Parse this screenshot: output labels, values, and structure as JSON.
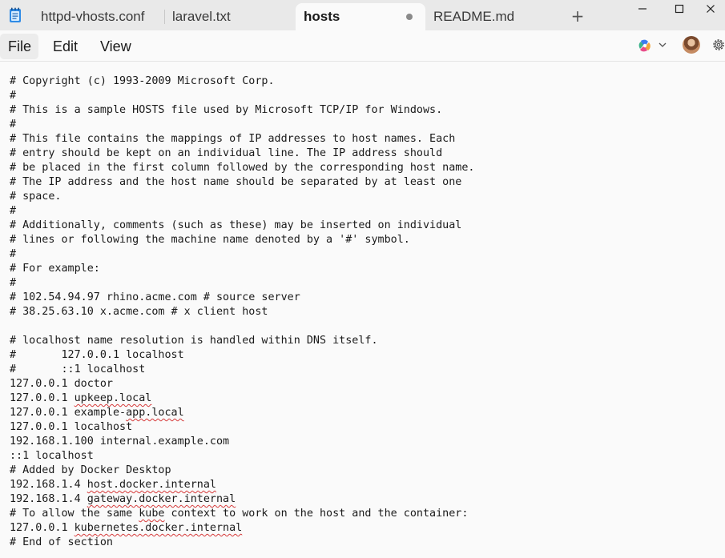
{
  "tabs": [
    {
      "label": "httpd-vhosts.conf",
      "active": false,
      "modified": false
    },
    {
      "label": "laravel.txt",
      "active": false,
      "modified": false
    },
    {
      "label": "hosts",
      "active": true,
      "modified": true
    },
    {
      "label": "README.md",
      "active": false,
      "modified": false
    }
  ],
  "new_tab_symbol": "+",
  "window_controls": {
    "minimize": "minimize-icon",
    "maximize": "maximize-icon",
    "close": "close-icon"
  },
  "menu": {
    "file": "File",
    "edit": "Edit",
    "view": "View"
  },
  "icons": {
    "app": "notepad-icon",
    "copilot": "copilot-icon",
    "chevron": "chevron-down-icon",
    "avatar": "avatar",
    "settings": "gear-icon"
  },
  "colors": {
    "accent": "#1f6fc5",
    "spellcheck": "#d63a3a"
  },
  "document": {
    "lines": [
      {
        "parts": [
          {
            "text": "# Copyright (c) 1993-2009 Microsoft Corp."
          }
        ]
      },
      {
        "parts": [
          {
            "text": "#"
          }
        ]
      },
      {
        "parts": [
          {
            "text": "# This is a sample HOSTS file used by Microsoft TCP/IP for Windows."
          }
        ]
      },
      {
        "parts": [
          {
            "text": "#"
          }
        ]
      },
      {
        "parts": [
          {
            "text": "# This file contains the mappings of IP addresses to host names. Each"
          }
        ]
      },
      {
        "parts": [
          {
            "text": "# entry should be kept on an individual line. The IP address should"
          }
        ]
      },
      {
        "parts": [
          {
            "text": "# be placed in the first column followed by the corresponding host name."
          }
        ]
      },
      {
        "parts": [
          {
            "text": "# The IP address and the host name should be separated by at least one"
          }
        ]
      },
      {
        "parts": [
          {
            "text": "# space."
          }
        ]
      },
      {
        "parts": [
          {
            "text": "#"
          }
        ]
      },
      {
        "parts": [
          {
            "text": "# Additionally, comments (such as these) may be inserted on individual"
          }
        ]
      },
      {
        "parts": [
          {
            "text": "# lines or following the machine name denoted by a '#' symbol."
          }
        ]
      },
      {
        "parts": [
          {
            "text": "#"
          }
        ]
      },
      {
        "parts": [
          {
            "text": "# For example:"
          }
        ]
      },
      {
        "parts": [
          {
            "text": "#"
          }
        ]
      },
      {
        "parts": [
          {
            "text": "# 102.54.94.97 rhino.acme.com # source server"
          }
        ]
      },
      {
        "parts": [
          {
            "text": "# 38.25.63.10 x.acme.com # x client host"
          }
        ]
      },
      {
        "parts": [
          {
            "text": ""
          }
        ]
      },
      {
        "parts": [
          {
            "text": "# localhost name resolution is handled within DNS itself."
          }
        ]
      },
      {
        "parts": [
          {
            "text": "#       127.0.0.1 localhost"
          }
        ]
      },
      {
        "parts": [
          {
            "text": "#       ::1 localhost"
          }
        ]
      },
      {
        "parts": [
          {
            "text": "127.0.0.1 doctor"
          }
        ]
      },
      {
        "parts": [
          {
            "text": "127.0.0.1 "
          },
          {
            "text": "upkeep.local",
            "spell": true
          }
        ]
      },
      {
        "parts": [
          {
            "text": "127.0.0.1 example-"
          },
          {
            "text": "app.local",
            "spell": true
          }
        ]
      },
      {
        "parts": [
          {
            "text": "127.0.0.1 localhost"
          }
        ]
      },
      {
        "parts": [
          {
            "text": "192.168.1.100 internal.example.com"
          }
        ]
      },
      {
        "parts": [
          {
            "text": "::1 localhost"
          }
        ]
      },
      {
        "parts": [
          {
            "text": "# Added by Docker Desktop"
          }
        ]
      },
      {
        "parts": [
          {
            "text": "192.168.1.4 "
          },
          {
            "text": "host.docker.internal",
            "spell": true
          }
        ]
      },
      {
        "parts": [
          {
            "text": "192.168.1.4 "
          },
          {
            "text": "gateway.docker.internal",
            "spell": true
          }
        ]
      },
      {
        "parts": [
          {
            "text": "# To allow the same "
          },
          {
            "text": "kube",
            "spell": true
          },
          {
            "text": " context to work on the host and the container:"
          }
        ]
      },
      {
        "parts": [
          {
            "text": "127.0.0.1 "
          },
          {
            "text": "kubernetes.docker.internal",
            "spell": true
          }
        ]
      },
      {
        "parts": [
          {
            "text": "# End of section"
          }
        ]
      }
    ]
  }
}
